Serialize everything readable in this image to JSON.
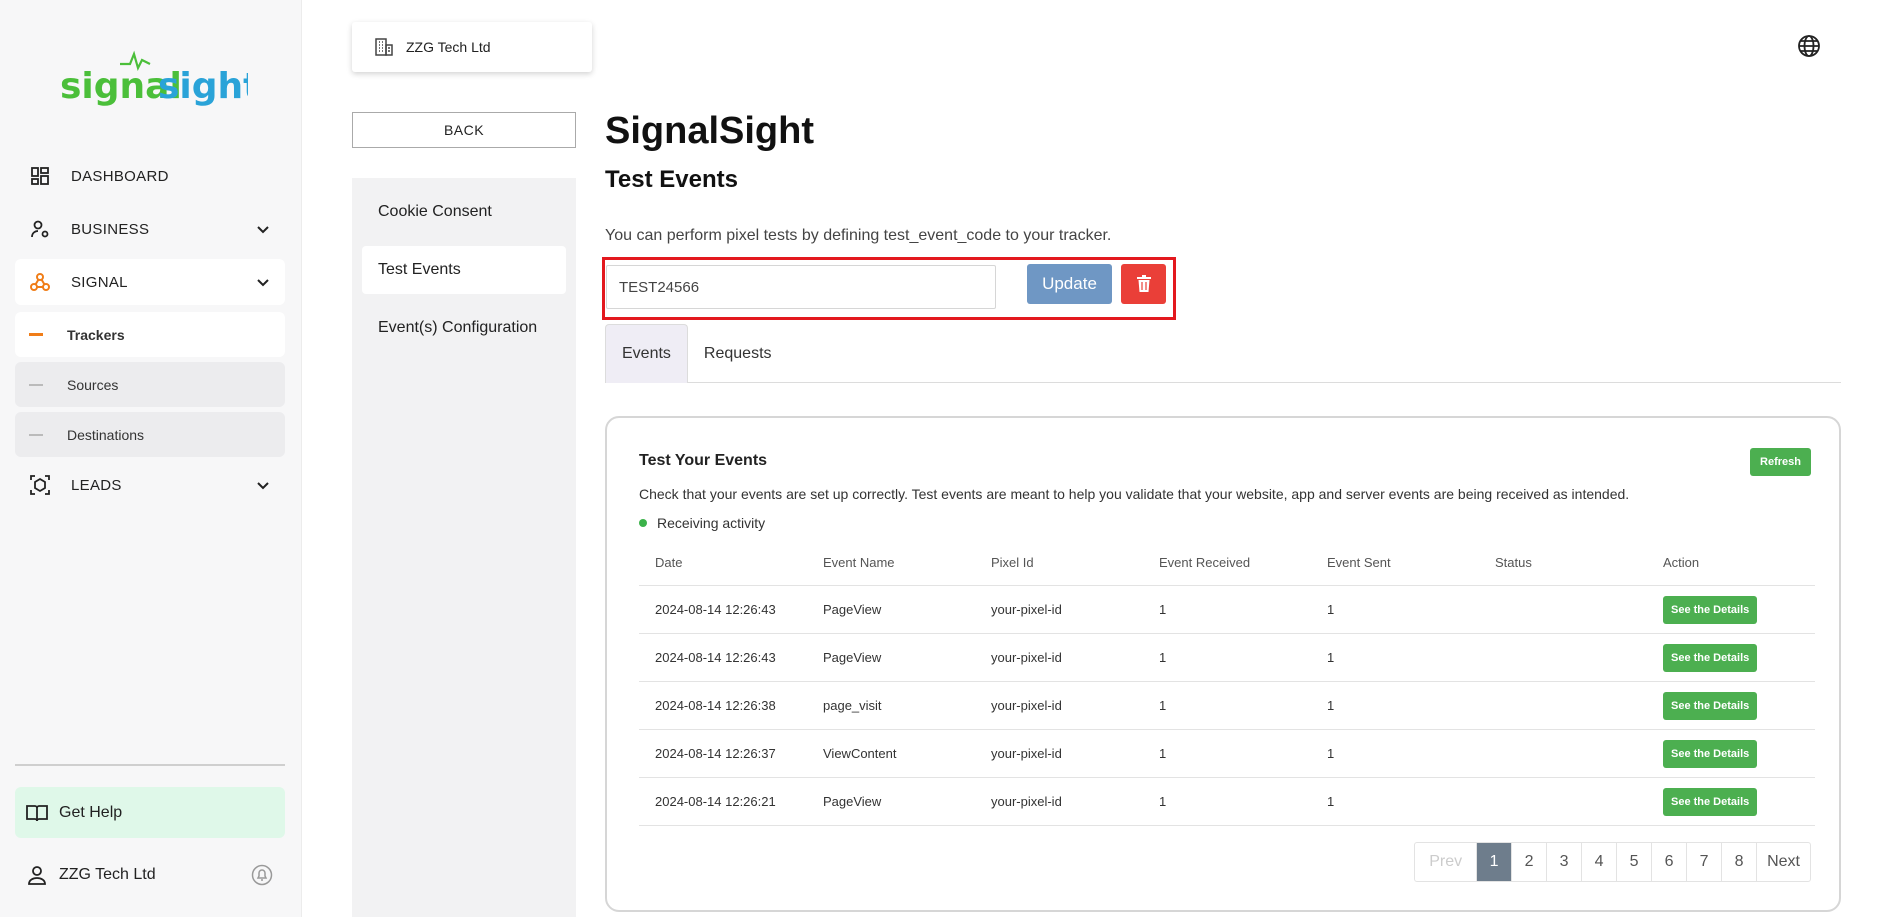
{
  "sidebar": {
    "logo": {
      "text_left": "signal",
      "text_right": "sight",
      "color_left": "#4bbf3a",
      "color_right": "#2aa3d8"
    },
    "nav": [
      {
        "label": "DASHBOARD",
        "icon": "dashboard-icon"
      },
      {
        "label": "BUSINESS",
        "icon": "user-settings-icon"
      },
      {
        "label": "SIGNAL",
        "icon": "webhook-icon"
      },
      {
        "label": "LEADS",
        "icon": "target-icon"
      }
    ],
    "sub_items": [
      {
        "label": "Trackers"
      },
      {
        "label": "Sources"
      },
      {
        "label": "Destinations"
      }
    ],
    "help_label": "Get Help",
    "user_label": "ZZG Tech Ltd"
  },
  "header": {
    "company": "ZZG Tech Ltd"
  },
  "back_label": "BACK",
  "panel": {
    "items": [
      {
        "label": "Cookie Consent"
      },
      {
        "label": "Test Events"
      },
      {
        "label": "Event(s) Configuration"
      }
    ]
  },
  "main": {
    "title": "SignalSight",
    "subtitle": "Test Events",
    "description": "You can perform pixel tests by defining test_event_code to your tracker.",
    "code_value": "TEST24566",
    "update_label": "Update",
    "tabs": [
      {
        "label": "Events"
      },
      {
        "label": "Requests"
      }
    ]
  },
  "card": {
    "title": "Test Your Events",
    "refresh_label": "Refresh",
    "description": "Check that your events are set up correctly. Test events are meant to help you validate that your website, app and server events are being received as intended.",
    "activity": "Receiving activity",
    "columns": [
      "Date",
      "Event Name",
      "Pixel Id",
      "Event Received",
      "Event Sent",
      "Status",
      "Action"
    ],
    "rows": [
      [
        "2024-08-14 12:26:43",
        "PageView",
        "your-pixel-id",
        "1",
        "1",
        "",
        "See the Details"
      ],
      [
        "2024-08-14 12:26:43",
        "PageView",
        "your-pixel-id",
        "1",
        "1",
        "",
        "See the Details"
      ],
      [
        "2024-08-14 12:26:38",
        "page_visit",
        "your-pixel-id",
        "1",
        "1",
        "",
        "See the Details"
      ],
      [
        "2024-08-14 12:26:37",
        "ViewContent",
        "your-pixel-id",
        "1",
        "1",
        "",
        "See the Details"
      ],
      [
        "2024-08-14 12:26:21",
        "PageView",
        "your-pixel-id",
        "1",
        "1",
        "",
        "See the Details"
      ]
    ],
    "pagination": {
      "prev": "Prev",
      "pages": [
        "1",
        "2",
        "3",
        "4",
        "5",
        "6",
        "7",
        "8"
      ],
      "next": "Next",
      "current": "1"
    }
  },
  "colors": {
    "accent_orange": "#f07d18",
    "highlight_red": "#e3181e",
    "green": "#4caf50",
    "update_blue": "#6f97c4"
  }
}
